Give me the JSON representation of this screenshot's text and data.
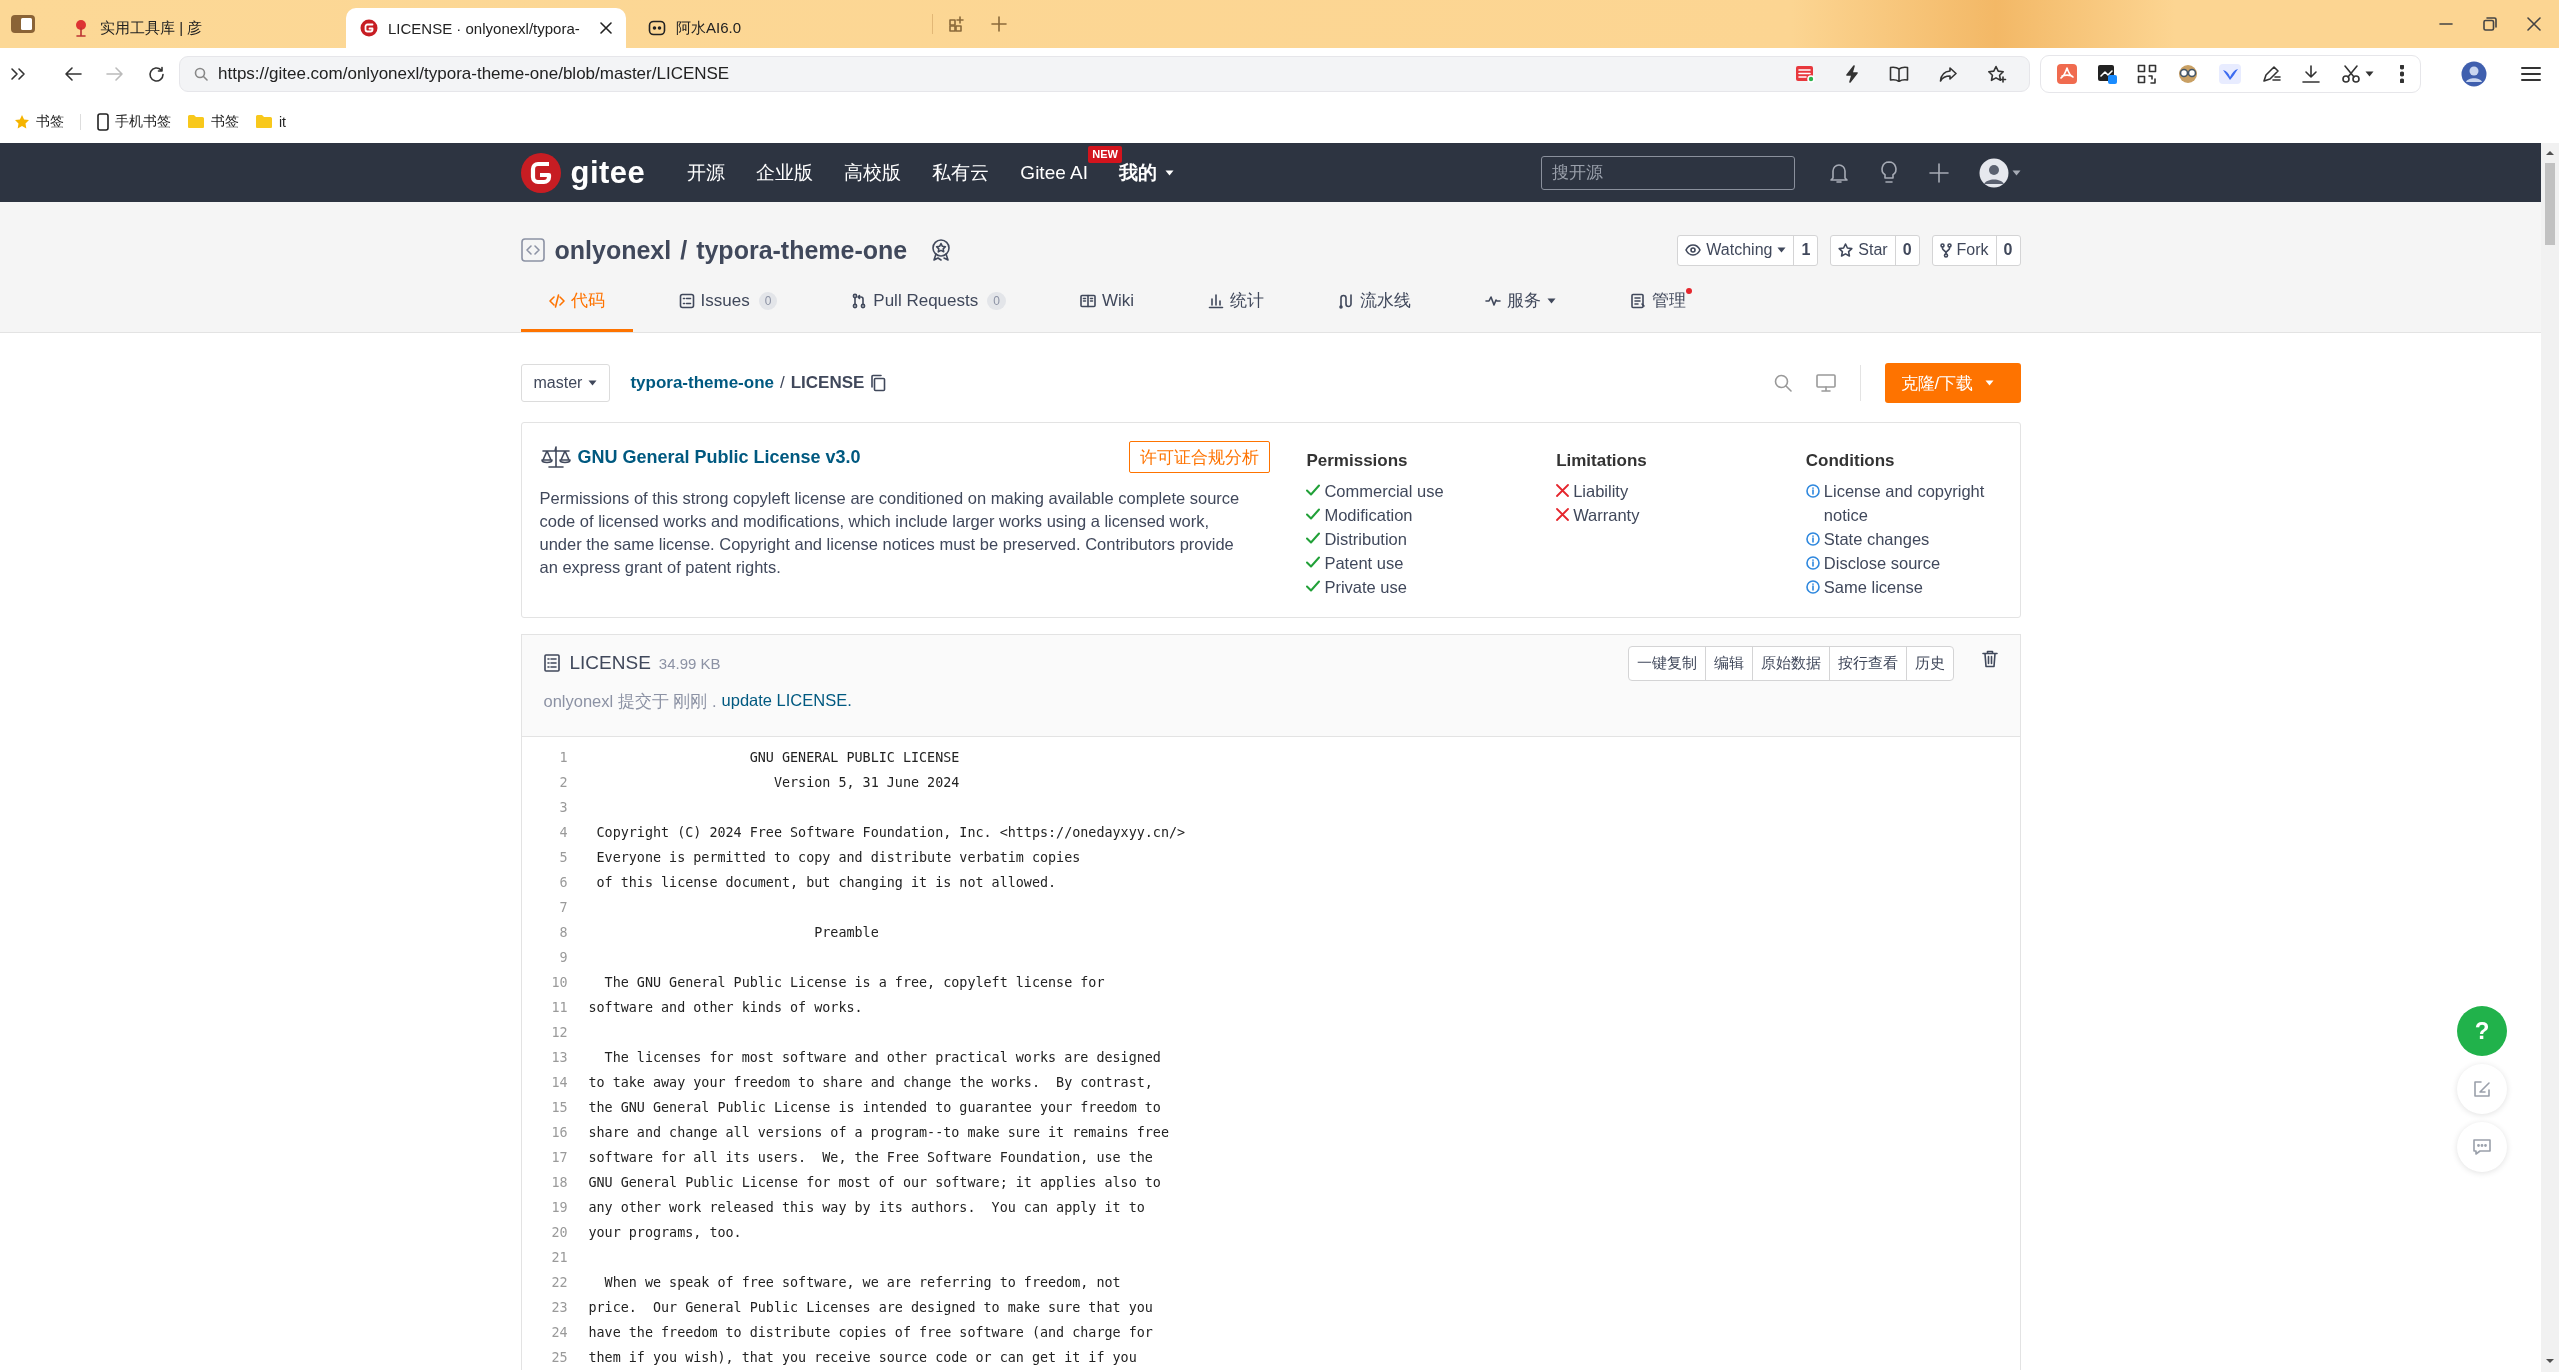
{
  "browser": {
    "tabs": [
      {
        "title": "实用工具库 | 彦",
        "kind": "tree",
        "selected": false
      },
      {
        "title": "LICENSE · onlyonexl/typora-",
        "kind": "gitee",
        "selected": true
      },
      {
        "title": "阿水AI6.0",
        "kind": "bot",
        "selected": false
      }
    ],
    "url": "https://gitee.com/onlyonexl/typora-theme-one/blob/master/LICENSE",
    "bookmarks": [
      {
        "label": "书签",
        "kind": "star"
      },
      {
        "label": "手机书签",
        "kind": "phone"
      },
      {
        "label": "书签",
        "kind": "folder"
      },
      {
        "label": "it",
        "kind": "folder"
      }
    ]
  },
  "top_nav": {
    "logo_text": "gitee",
    "items": [
      {
        "label": "开源",
        "dropdown": false
      },
      {
        "label": "企业版",
        "dropdown": false
      },
      {
        "label": "高校版",
        "dropdown": false
      },
      {
        "label": "私有云",
        "dropdown": false
      },
      {
        "label": "Gitee AI",
        "badge": "NEW",
        "dropdown": false
      },
      {
        "label": "我的",
        "dropdown": true
      }
    ],
    "search": {
      "placeholder": "搜开源"
    }
  },
  "repo": {
    "owner": "onlyonexl",
    "separator": "/",
    "name": "typora-theme-one",
    "actions": [
      {
        "label": "Watching",
        "kind": "eye",
        "count": "1",
        "dropdown": true
      },
      {
        "label": "Star",
        "kind": "star",
        "count": "0",
        "dropdown": false
      },
      {
        "label": "Fork",
        "kind": "fork",
        "count": "0",
        "dropdown": false
      }
    ],
    "tabs": [
      {
        "label": "代码",
        "kind": "code",
        "selected": true,
        "dropdown": false,
        "dot": false
      },
      {
        "label": "Issues",
        "kind": "issues",
        "count": "0",
        "selected": false,
        "dropdown": false,
        "dot": false
      },
      {
        "label": "Pull Requests",
        "kind": "pr",
        "count": "0",
        "selected": false,
        "dropdown": false,
        "dot": false
      },
      {
        "label": "Wiki",
        "kind": "wiki",
        "selected": false,
        "dropdown": false,
        "dot": false
      },
      {
        "label": "统计",
        "kind": "stats",
        "selected": false,
        "dropdown": false,
        "dot": false
      },
      {
        "label": "流水线",
        "kind": "pipeline",
        "selected": false,
        "dropdown": false,
        "dot": false
      },
      {
        "label": "服务",
        "kind": "service",
        "selected": false,
        "dropdown": true,
        "dot": false
      },
      {
        "label": "管理",
        "kind": "admin",
        "selected": false,
        "dropdown": false,
        "dot": true
      }
    ]
  },
  "path": {
    "branch": "master",
    "repo": "typora-theme-one",
    "separator": "/",
    "file": "LICENSE",
    "clone_button": "克隆/下载"
  },
  "license": {
    "title": "GNU General Public License v3.0",
    "analysis_button": "许可证合规分析",
    "description": "Permissions of this strong copyleft license are conditioned on making available complete source code of licensed works and modifications, which include larger works using a licensed work, under the same license. Copyright and license notices must be preserved. Contributors provide an express grant of patent rights.",
    "columns": [
      {
        "heading": "Permissions",
        "kind": "check",
        "items": [
          "Commercial use",
          "Modification",
          "Distribution",
          "Patent use",
          "Private use"
        ]
      },
      {
        "heading": "Limitations",
        "kind": "cross",
        "items": [
          "Liability",
          "Warranty"
        ]
      },
      {
        "heading": "Conditions",
        "kind": "info",
        "items": [
          "License and copyright notice",
          "State changes",
          "Disclose source",
          "Same license"
        ]
      }
    ]
  },
  "file": {
    "name": "LICENSE",
    "size": "34.99 KB",
    "commit_meta": "onlyonexl 提交于 刚刚 .",
    "commit_message": "update LICENSE.",
    "buttons": [
      "一键复制",
      "编辑",
      "原始数据",
      "按行查看",
      "历史"
    ],
    "lines": [
      {
        "number": "1",
        "text": "                    GNU GENERAL PUBLIC LICENSE"
      },
      {
        "number": "2",
        "text": "                       Version 5, 31 June 2024"
      },
      {
        "number": "3"
      },
      {
        "number": "4",
        "text": " Copyright (C) 2024 Free Software Foundation, Inc. <https://onedayxyy.cn/>"
      },
      {
        "number": "5",
        "text": " Everyone is permitted to copy and distribute verbatim copies"
      },
      {
        "number": "6",
        "text": " of this license document, but changing it is not allowed."
      },
      {
        "number": "7"
      },
      {
        "number": "8",
        "text": "                            Preamble"
      },
      {
        "number": "9"
      },
      {
        "number": "10",
        "text": "  The GNU General Public License is a free, copyleft license for"
      },
      {
        "number": "11",
        "text": "software and other kinds of works."
      },
      {
        "number": "12"
      },
      {
        "number": "13",
        "text": "  The licenses for most software and other practical works are designed"
      },
      {
        "number": "14",
        "text": "to take away your freedom to share and change the works.  By contrast,"
      },
      {
        "number": "15",
        "text": "the GNU General Public License is intended to guarantee your freedom to"
      },
      {
        "number": "16",
        "text": "share and change all versions of a program--to make sure it remains free"
      },
      {
        "number": "17",
        "text": "software for all its users.  We, the Free Software Foundation, use the"
      },
      {
        "number": "18",
        "text": "GNU General Public License for most of our software; it applies also to"
      },
      {
        "number": "19",
        "text": "any other work released this way by its authors.  You can apply it to"
      },
      {
        "number": "20",
        "text": "your programs, too."
      },
      {
        "number": "21"
      },
      {
        "number": "22",
        "text": "  When we speak of free software, we are referring to freedom, not"
      },
      {
        "number": "23",
        "text": "price.  Our General Public Licenses are designed to make sure that you"
      },
      {
        "number": "24",
        "text": "have the freedom to distribute copies of free software (and charge for"
      },
      {
        "number": "25",
        "text": "them if you wish), that you receive source code or can get it if you"
      }
    ]
  },
  "float_buttons": [
    {
      "kind": "help",
      "label": "?"
    },
    {
      "kind": "feedback"
    },
    {
      "kind": "chat"
    }
  ]
}
